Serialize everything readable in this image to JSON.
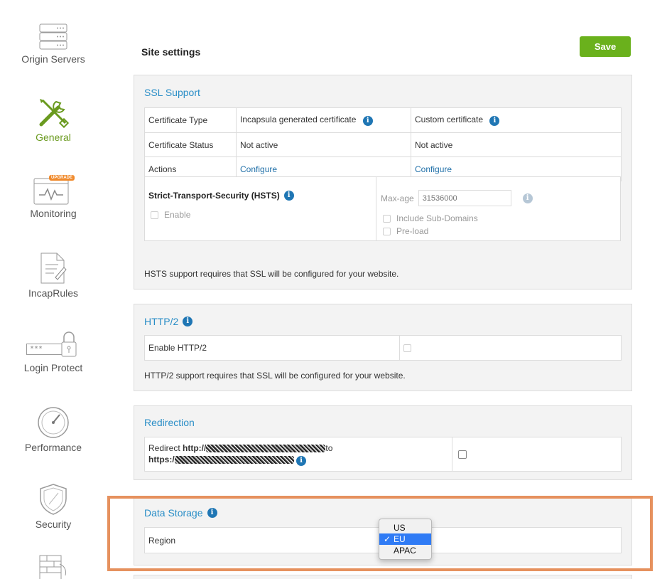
{
  "sidebar": {
    "items": [
      {
        "label": "Origin Servers",
        "icon": "server-icon",
        "active": false
      },
      {
        "label": "General",
        "icon": "tools-icon",
        "active": true
      },
      {
        "label": "Monitoring",
        "icon": "monitoring-icon",
        "badge": "UPGRADE",
        "active": false
      },
      {
        "label": "IncapRules",
        "icon": "document-edit-icon",
        "active": false
      },
      {
        "label": "Login Protect",
        "icon": "password-lock-icon",
        "password_mask": "***",
        "active": false
      },
      {
        "label": "Performance",
        "icon": "speedometer-icon",
        "active": false
      },
      {
        "label": "Security",
        "icon": "shield-icon",
        "active": false
      },
      {
        "icon": "firewall-icon",
        "active": false
      }
    ]
  },
  "header": {
    "title": "Site settings",
    "save_label": "Save"
  },
  "ssl": {
    "title": "SSL Support",
    "rows": [
      {
        "label": "Certificate Type",
        "col1": "Incapsula generated certificate",
        "col2": "Custom certificate"
      },
      {
        "label": "Certificate Status",
        "col1": "Not active",
        "col2": "Not active"
      },
      {
        "label": "Actions",
        "col1": "Configure",
        "col2": "Configure"
      }
    ],
    "hsts": {
      "title": "Strict-Transport-Security (HSTS)",
      "enable_label": "Enable",
      "maxage_label": "Max-age",
      "maxage_placeholder": "31536000",
      "include_sub_label": "Include Sub-Domains",
      "preload_label": "Pre-load"
    },
    "note": "HSTS support requires that SSL will be configured for your website."
  },
  "http2": {
    "title": "HTTP/2",
    "row_label": "Enable HTTP/2",
    "note": "HTTP/2 support requires that SSL will be configured for your website."
  },
  "redirection": {
    "title": "Redirection",
    "line1_prefix": "Redirect ",
    "line1_bold": "http://",
    "line1_suffix": "to",
    "line2_bold": "https:/"
  },
  "data_storage": {
    "title": "Data Storage",
    "region_label": "Region",
    "options": [
      "US",
      "EU",
      "APAC"
    ],
    "selected": "EU",
    "check": "✓"
  },
  "colors": {
    "accent": "#6ab11c",
    "link": "#2a8ec7",
    "highlight": "#e6915e",
    "selected": "#2f7bf5"
  }
}
